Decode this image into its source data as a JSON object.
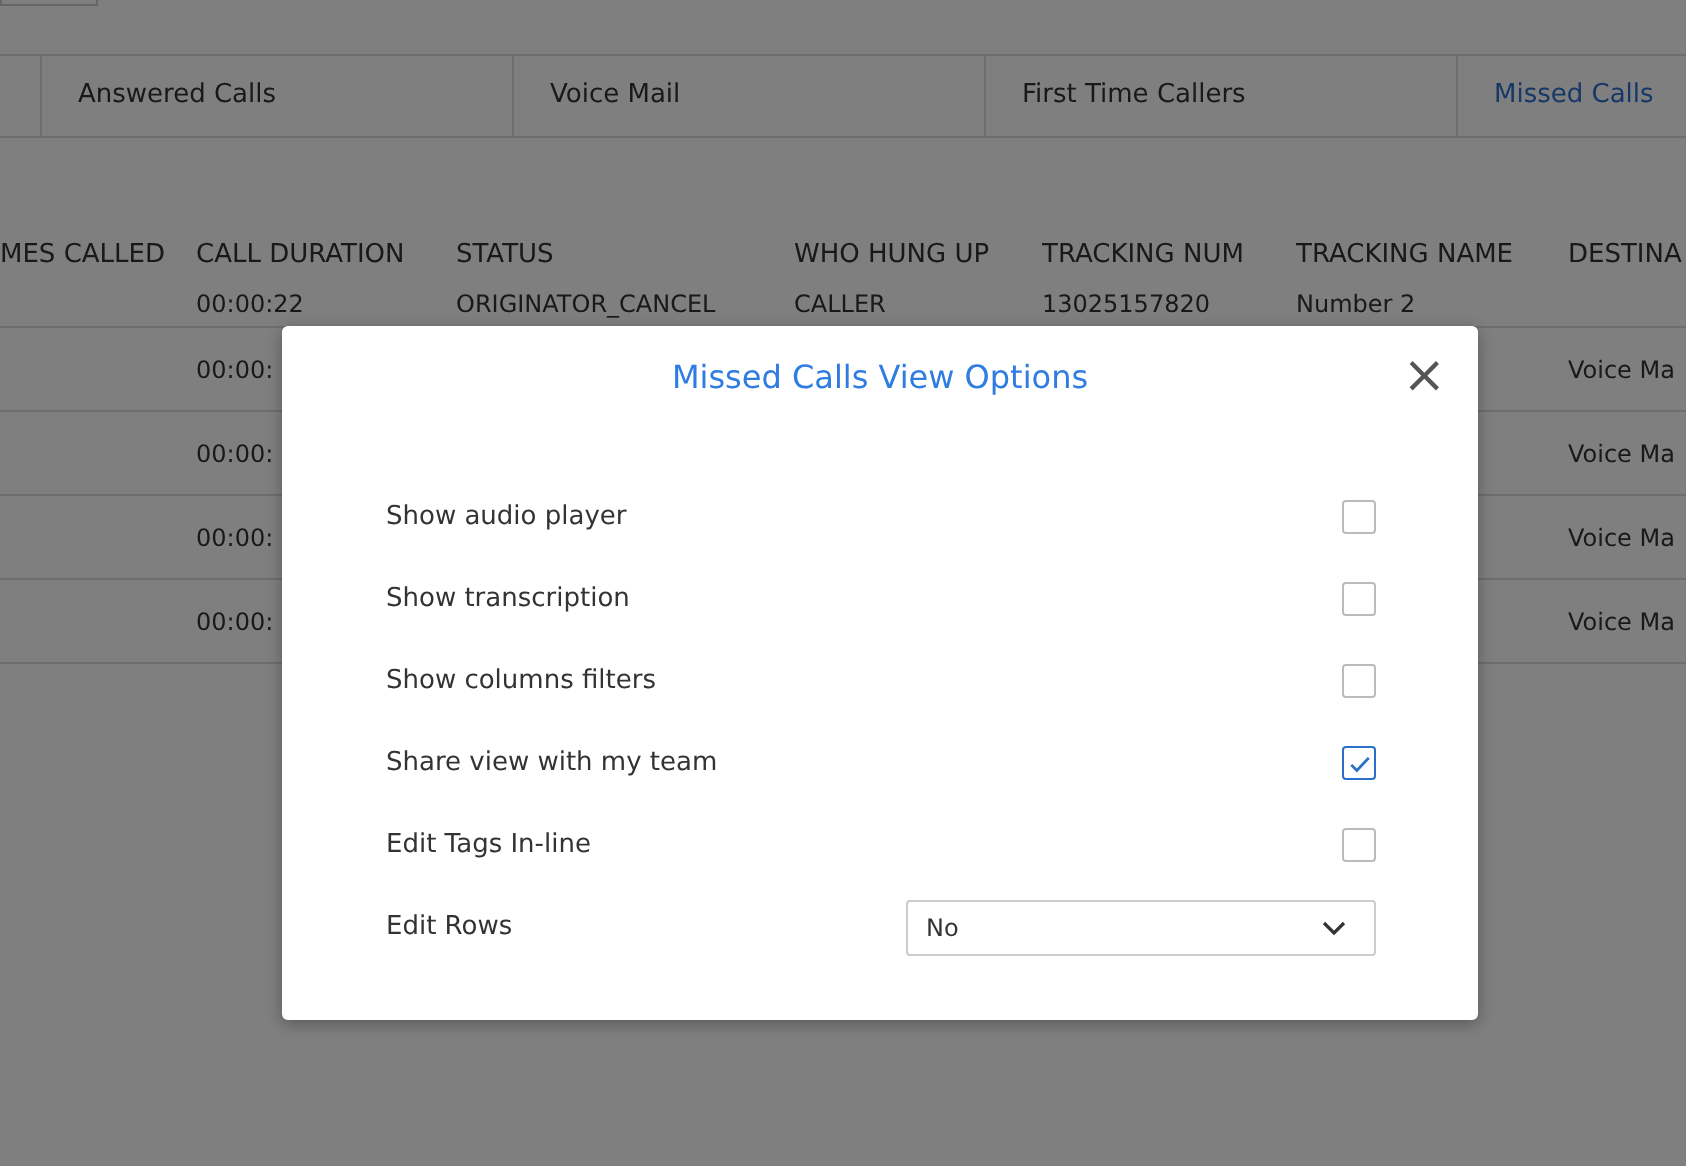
{
  "tabs": [
    {
      "label": "Answered Calls",
      "selected": false
    },
    {
      "label": "Voice Mail",
      "selected": false
    },
    {
      "label": "First Time Callers",
      "selected": false
    },
    {
      "label": "Missed Calls",
      "selected": true
    }
  ],
  "table": {
    "columns": [
      "MES CALLED",
      "CALL DURATION",
      "STATUS",
      "WHO HUNG UP",
      "TRACKING NUM",
      "TRACKING NAME",
      "DESTINA"
    ],
    "rows": [
      [
        "",
        "00:00:22",
        "ORIGINATOR_CANCEL",
        "CALLER",
        "13025157820",
        "Number 2",
        ""
      ],
      [
        "",
        "00:00:",
        "",
        "",
        "",
        "",
        "Voice Ma"
      ],
      [
        "",
        "00:00:",
        "",
        "",
        "",
        "",
        "Voice Ma"
      ],
      [
        "",
        "00:00:",
        "",
        "",
        "",
        "",
        "Voice Ma"
      ],
      [
        "",
        "00:00:",
        "",
        "",
        "",
        "",
        "Voice Ma"
      ]
    ]
  },
  "dialog": {
    "title": "Missed Calls View Options",
    "close": "×",
    "options": [
      {
        "kind": "checkbox",
        "label": "Show audio player",
        "checked": false
      },
      {
        "kind": "checkbox",
        "label": "Show transcription",
        "checked": false
      },
      {
        "kind": "checkbox",
        "label": "Show columns filters",
        "checked": false
      },
      {
        "kind": "checkbox",
        "label": "Share view with my team",
        "checked": true
      },
      {
        "kind": "checkbox",
        "label": "Edit Tags In-line",
        "checked": false
      },
      {
        "kind": "select",
        "label": "Edit Rows",
        "value": "No"
      }
    ]
  }
}
